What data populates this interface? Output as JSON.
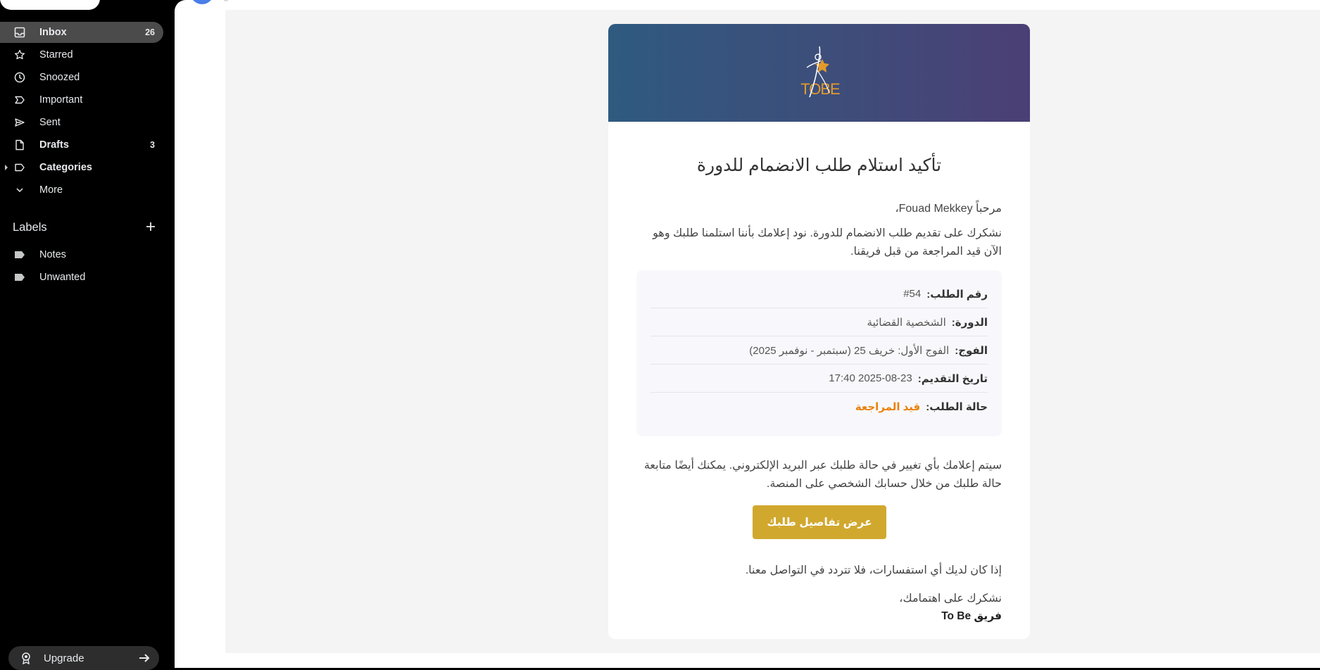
{
  "sidebar": {
    "items": [
      {
        "name": "inbox",
        "label": "Inbox",
        "count": "26",
        "bold": true,
        "active": true
      },
      {
        "name": "starred",
        "label": "Starred",
        "count": ""
      },
      {
        "name": "snoozed",
        "label": "Snoozed",
        "count": ""
      },
      {
        "name": "important",
        "label": "Important",
        "count": ""
      },
      {
        "name": "sent",
        "label": "Sent",
        "count": ""
      },
      {
        "name": "drafts",
        "label": "Drafts",
        "count": "3",
        "bold": true
      },
      {
        "name": "categories",
        "label": "Categories",
        "count": "",
        "bold": true
      },
      {
        "name": "more",
        "label": "More",
        "count": ""
      }
    ],
    "labels_header": "Labels",
    "labels": [
      {
        "label": "Notes"
      },
      {
        "label": "Unwanted"
      }
    ],
    "upgrade_label": "Upgrade"
  },
  "email": {
    "logo_text": "TOBE",
    "title": "تأكيد استلام طلب الانضمام للدورة",
    "greeting": "مرحباً Fouad Mekkey،",
    "intro": "نشكرك على تقديم طلب الانضمام للدورة. نود إعلامك بأننا استلمنا طلبك وهو الآن قيد المراجعة من قبل فريقنا.",
    "details": [
      {
        "key": "رقم الطلب:",
        "value": "#54"
      },
      {
        "key": "الدورة:",
        "value": "الشخصية القضائية"
      },
      {
        "key": "الفوج:",
        "value": "الفوج الأول: خريف 25 (سبتمبر - نوفمبر 2025)"
      },
      {
        "key": "تاريخ التقديم:",
        "value": "2025-08-23 17:40"
      },
      {
        "key": "حالة الطلب:",
        "value": "قيد المراجعة"
      }
    ],
    "notice": "سيتم إعلامك بأي تغيير في حالة طلبك عبر البريد الإلكتروني. يمكنك أيضًا متابعة حالة طلبك من خلال حسابك الشخصي على المنصة.",
    "cta_label": "عرض تفاصيل طلبك",
    "contact": "إذا كان لديك أي استفسارات، فلا تتردد في التواصل معنا.",
    "thanks": "نشكرك على اهتمامك،",
    "signature": "فريق To Be"
  },
  "colors": {
    "accent_gold": "#d1a82e",
    "status_orange": "#e8820e",
    "header_gradient_start": "#2f5a80",
    "header_gradient_end": "#4b3f76"
  }
}
